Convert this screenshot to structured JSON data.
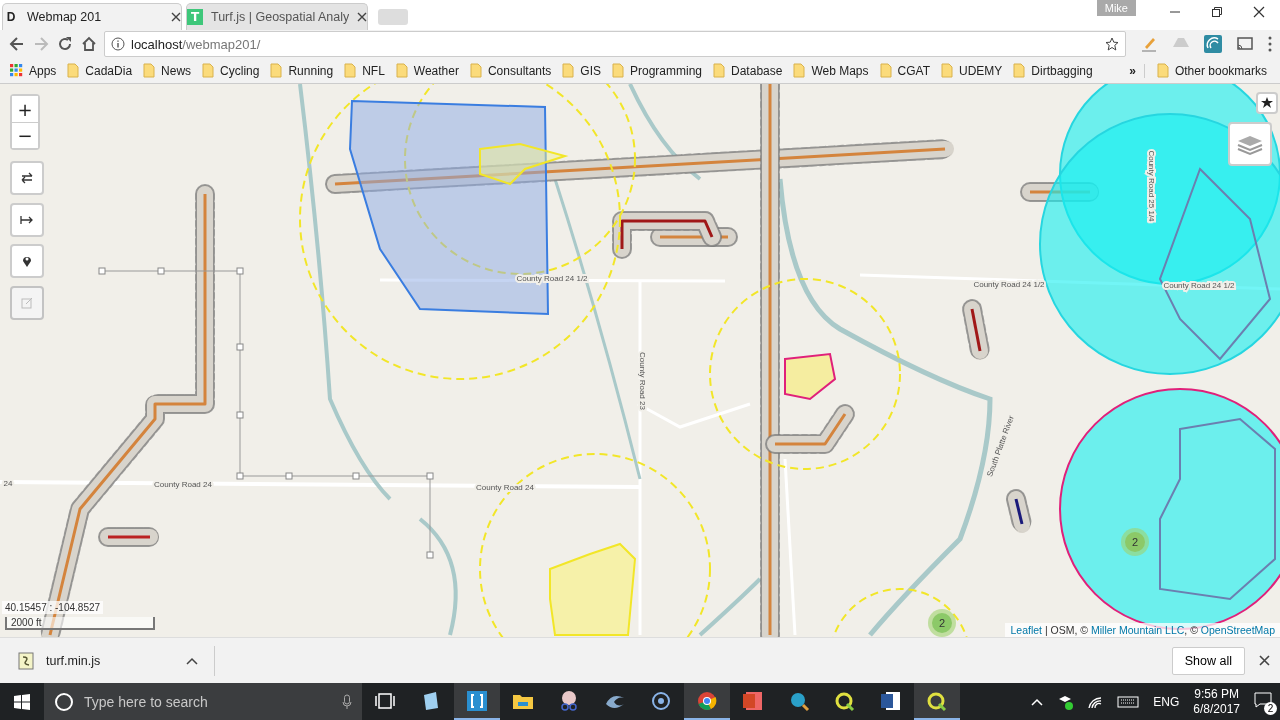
{
  "tabs": [
    {
      "title": "Webmap 201",
      "favicon": "D",
      "selected": true
    },
    {
      "title": "Turf.js | Geospatial Analy",
      "favicon": "T",
      "selected": false
    }
  ],
  "profile": "Mike",
  "address": {
    "host": "localhost",
    "path": "/webmap201/"
  },
  "bookmarks": [
    {
      "label": "Apps",
      "kind": "apps"
    },
    {
      "label": "CadaDia",
      "kind": "folder"
    },
    {
      "label": "News",
      "kind": "folder"
    },
    {
      "label": "Cycling",
      "kind": "folder"
    },
    {
      "label": "Running",
      "kind": "folder"
    },
    {
      "label": "NFL",
      "kind": "folder"
    },
    {
      "label": "Weather",
      "kind": "folder"
    },
    {
      "label": "Consultants",
      "kind": "folder"
    },
    {
      "label": "GIS",
      "kind": "folder"
    },
    {
      "label": "Programming",
      "kind": "folder"
    },
    {
      "label": "Database",
      "kind": "folder"
    },
    {
      "label": "Web Maps",
      "kind": "folder"
    },
    {
      "label": "CGAT",
      "kind": "folder"
    },
    {
      "label": "UDEMY",
      "kind": "folder"
    },
    {
      "label": "Dirtbagging",
      "kind": "folder"
    }
  ],
  "bookmarks_overflow": "»",
  "other_bookmarks": "Other bookmarks",
  "map": {
    "zoom_in": "+",
    "zoom_out": "−",
    "road_labels": [
      "County Road 24 1/2",
      "County Road 24 1/2",
      "County Road 24 1/2",
      "County Road 24",
      "County Road 24",
      "24",
      "County Road 23",
      "County Road 25 1/4",
      "South Platte River"
    ],
    "clusters": [
      "2",
      "2"
    ],
    "coordinates": "40.15457 : -104.8527",
    "scale": "2000 ft",
    "attribution": [
      {
        "text": "Leaflet",
        "link": true
      },
      {
        "text": " | OSM, © ",
        "link": false
      },
      {
        "text": "Miller Mountain LLC",
        "link": true
      },
      {
        "text": ", © ",
        "link": false
      },
      {
        "text": "OpenStreetMap",
        "link": true
      }
    ]
  },
  "download": {
    "file": "turf.min.js",
    "show_all": "Show all"
  },
  "taskbar": {
    "search_placeholder": "Type here to search",
    "apps": [
      {
        "kind": "taskview",
        "selected": false
      },
      {
        "kind": "notepad",
        "selected": false
      },
      {
        "kind": "brackets",
        "selected": true
      },
      {
        "kind": "explorer",
        "selected": false
      },
      {
        "kind": "snip",
        "selected": false
      },
      {
        "kind": "browser2",
        "selected": false
      },
      {
        "kind": "cortana",
        "selected": false
      },
      {
        "kind": "chrome",
        "selected": true
      },
      {
        "kind": "powerpoint",
        "selected": false
      },
      {
        "kind": "search",
        "selected": false
      },
      {
        "kind": "qgis",
        "selected": false
      },
      {
        "kind": "word",
        "selected": false
      },
      {
        "kind": "qgis",
        "selected": true
      }
    ],
    "language": "ENG",
    "time": "9:56 PM",
    "date": "6/8/2017",
    "notifications": "2"
  }
}
